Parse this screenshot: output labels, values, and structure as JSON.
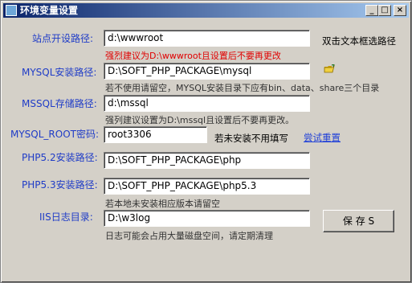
{
  "window": {
    "title": "环境变量设置"
  },
  "titlebar": {
    "min_glyph": "_",
    "max_glyph": "□",
    "close_glyph": "×"
  },
  "site_dir": {
    "label": "站点开设路径:",
    "value": "d:\\wwwroot",
    "hint": "强烈建议为D:\\wwwroot且设置后不要再更改",
    "side_text": "双击文本框选路径"
  },
  "mysql_install": {
    "label": "MYSQL安装路径:",
    "value": "D:\\SOFT_PHP_PACKAGE\\mysql",
    "hint": "若不使用请留空，MYSQL安装目录下应有bin、data、share三个目录",
    "icon": "folder-icon"
  },
  "mssql_store": {
    "label": "MSSQL存储路径:",
    "value": "d:\\mssql",
    "hint": "强列建议设置为D:\\mssql且设置后不要再更改。"
  },
  "mysql_root": {
    "label": "MYSQL_ROOT密码:",
    "value": "root3306",
    "side_text": "若未安装不用填写",
    "link": "尝试重置"
  },
  "php52": {
    "label": "PHP5.2安装路径:",
    "value": "D:\\SOFT_PHP_PACKAGE\\php"
  },
  "php53": {
    "label": "PHP5.3安装路径:",
    "value": "D:\\SOFT_PHP_PACKAGE\\php5.3",
    "hint": "若本地未安装相应版本请留空"
  },
  "iis_log": {
    "label": "IIS日志目录:",
    "value": "D:\\w3log",
    "hint": "日志可能会占用大量磁盘空间，请定期清理"
  },
  "save_button": {
    "label": "保 存 S"
  },
  "colors": {
    "label": "#1f3cc7",
    "warning": "#e00000",
    "link": "#2040d8",
    "title_start": "#0a246a",
    "title_end": "#a6caf0"
  }
}
